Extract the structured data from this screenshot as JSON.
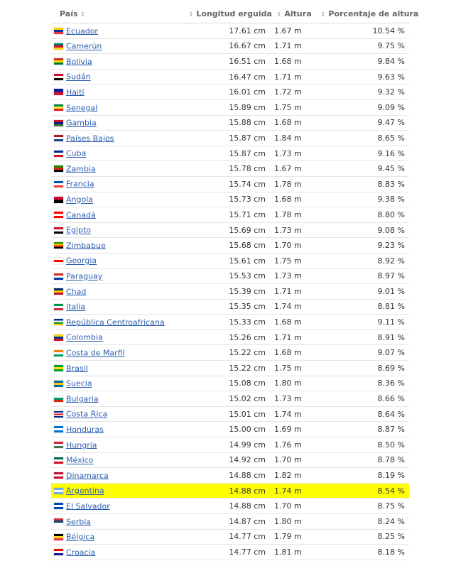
{
  "table": {
    "headers": {
      "country": "País",
      "length": "Longitud erguida",
      "height": "Altura",
      "percent": "Porcentaje de altura"
    },
    "sort_icon": "sort-icon",
    "highlight_color": "#ffff00",
    "link_color": "#2a5db0",
    "rows": [
      {
        "country": "Ecuador",
        "length": "17.61 cm",
        "height": "1.67 m",
        "percent": "10.54 %",
        "flag": [
          "#ffd100",
          "#0033a0",
          "#ef3340"
        ]
      },
      {
        "country": "Camerún",
        "length": "16.67 cm",
        "height": "1.71 m",
        "percent": "9.75 %",
        "flag": [
          "#007a5e",
          "#ce1126",
          "#fcd116"
        ]
      },
      {
        "country": "Bolivia",
        "length": "16.51 cm",
        "height": "1.68 m",
        "percent": "9.84 %",
        "flag": [
          "#d52b1e",
          "#f9e300",
          "#007934"
        ]
      },
      {
        "country": "Sudán",
        "length": "16.47 cm",
        "height": "1.71 m",
        "percent": "9.63 %",
        "flag": [
          "#d21034",
          "#ffffff",
          "#000000"
        ]
      },
      {
        "country": "Haití",
        "length": "16.01 cm",
        "height": "1.72 m",
        "percent": "9.32 %",
        "flag": [
          "#00209f",
          "#d21034"
        ]
      },
      {
        "country": "Senegal",
        "length": "15.89 cm",
        "height": "1.75 m",
        "percent": "9.09 %",
        "flag": [
          "#00853f",
          "#fdef42",
          "#e31b23"
        ]
      },
      {
        "country": "Gambia",
        "length": "15.88 cm",
        "height": "1.68 m",
        "percent": "9.47 %",
        "flag": [
          "#ce1126",
          "#0c1c8c",
          "#3a7728"
        ]
      },
      {
        "country": "Países Bajos",
        "length": "15.87 cm",
        "height": "1.84 m",
        "percent": "8.65 %",
        "flag": [
          "#ae1c28",
          "#ffffff",
          "#21468b"
        ]
      },
      {
        "country": "Cuba",
        "length": "15.87 cm",
        "height": "1.73 m",
        "percent": "9.16 %",
        "flag": [
          "#002a8f",
          "#ffffff",
          "#cf142b"
        ]
      },
      {
        "country": "Zambia",
        "length": "15.78 cm",
        "height": "1.67 m",
        "percent": "9.45 %",
        "flag": [
          "#198a00",
          "#de2010",
          "#000000"
        ]
      },
      {
        "country": "Francia",
        "length": "15.74 cm",
        "height": "1.78 m",
        "percent": "8.83 %",
        "flag": [
          "#0055a4",
          "#ffffff",
          "#ef4135"
        ]
      },
      {
        "country": "Angola",
        "length": "15.73 cm",
        "height": "1.68 m",
        "percent": "9.38 %",
        "flag": [
          "#cc092f",
          "#000000"
        ]
      },
      {
        "country": "Canadá",
        "length": "15.71 cm",
        "height": "1.78 m",
        "percent": "8.80 %",
        "flag": [
          "#ff0000",
          "#ffffff",
          "#ff0000"
        ]
      },
      {
        "country": "Egipto",
        "length": "15.69 cm",
        "height": "1.73 m",
        "percent": "9.08 %",
        "flag": [
          "#ce1126",
          "#ffffff",
          "#000000"
        ]
      },
      {
        "country": "Zimbabue",
        "length": "15.68 cm",
        "height": "1.70 m",
        "percent": "9.23 %",
        "flag": [
          "#319208",
          "#ffd200",
          "#de2010",
          "#000000"
        ]
      },
      {
        "country": "Georgia",
        "length": "15.61 cm",
        "height": "1.75 m",
        "percent": "8.92 %",
        "flag": [
          "#ffffff",
          "#ff0000",
          "#ffffff"
        ]
      },
      {
        "country": "Paraguay",
        "length": "15.53 cm",
        "height": "1.73 m",
        "percent": "8.97 %",
        "flag": [
          "#d52b1e",
          "#ffffff",
          "#0038a8"
        ]
      },
      {
        "country": "Chad",
        "length": "15.39 cm",
        "height": "1.71 m",
        "percent": "9.01 %",
        "flag": [
          "#002664",
          "#fecb00",
          "#c60c30"
        ]
      },
      {
        "country": "Italia",
        "length": "15.35 cm",
        "height": "1.74 m",
        "percent": "8.81 %",
        "flag": [
          "#009246",
          "#ffffff",
          "#ce2b37"
        ]
      },
      {
        "country": "República Centroafricana",
        "length": "15.33 cm",
        "height": "1.68 m",
        "percent": "9.11 %",
        "flag": [
          "#003082",
          "#ffffff",
          "#289728",
          "#ffce00"
        ]
      },
      {
        "country": "Colombia",
        "length": "15.26 cm",
        "height": "1.71 m",
        "percent": "8.91 %",
        "flag": [
          "#fcd116",
          "#003893",
          "#ce1126"
        ]
      },
      {
        "country": "Costa de Marfil",
        "length": "15.22 cm",
        "height": "1.68 m",
        "percent": "9.07 %",
        "flag": [
          "#f77f00",
          "#ffffff",
          "#009e60"
        ]
      },
      {
        "country": "Brasil",
        "length": "15.22 cm",
        "height": "1.75 m",
        "percent": "8.69 %",
        "flag": [
          "#009c3b",
          "#ffdf00",
          "#009c3b"
        ]
      },
      {
        "country": "Suecia",
        "length": "15.08 cm",
        "height": "1.80 m",
        "percent": "8.36 %",
        "flag": [
          "#006aa7",
          "#fecc00",
          "#006aa7"
        ]
      },
      {
        "country": "Bulgaria",
        "length": "15.02 cm",
        "height": "1.73 m",
        "percent": "8.66 %",
        "flag": [
          "#ffffff",
          "#00966e",
          "#d62612"
        ]
      },
      {
        "country": "Costa Rica",
        "length": "15.01 cm",
        "height": "1.74 m",
        "percent": "8.64 %",
        "flag": [
          "#002b7f",
          "#ffffff",
          "#ce1126",
          "#ffffff",
          "#002b7f"
        ]
      },
      {
        "country": "Honduras",
        "length": "15.00 cm",
        "height": "1.69 m",
        "percent": "8.87 %",
        "flag": [
          "#0073cf",
          "#ffffff",
          "#0073cf"
        ]
      },
      {
        "country": "Hungría",
        "length": "14.99 cm",
        "height": "1.76 m",
        "percent": "8.50 %",
        "flag": [
          "#ce2939",
          "#ffffff",
          "#477050"
        ]
      },
      {
        "country": "México",
        "length": "14.92 cm",
        "height": "1.70 m",
        "percent": "8.78 %",
        "flag": [
          "#006847",
          "#ffffff",
          "#ce1126"
        ]
      },
      {
        "country": "Dinamarca",
        "length": "14.88 cm",
        "height": "1.82 m",
        "percent": "8.19 %",
        "flag": [
          "#c8102e",
          "#ffffff",
          "#c8102e"
        ]
      },
      {
        "country": "Argentina",
        "length": "14.88 cm",
        "height": "1.74 m",
        "percent": "8.54 %",
        "flag": [
          "#74acdf",
          "#ffffff",
          "#74acdf"
        ],
        "highlight": true
      },
      {
        "country": "El Salvador",
        "length": "14.88 cm",
        "height": "1.70 m",
        "percent": "8.75 %",
        "flag": [
          "#0047ab",
          "#ffffff",
          "#0047ab"
        ]
      },
      {
        "country": "Serbia",
        "length": "14.87 cm",
        "height": "1.80 m",
        "percent": "8.24 %",
        "flag": [
          "#c6363c",
          "#0c4076",
          "#ffffff"
        ]
      },
      {
        "country": "Bélgica",
        "length": "14.77 cm",
        "height": "1.79 m",
        "percent": "8.25 %",
        "flag": [
          "#000000",
          "#fdda24",
          "#ef3340"
        ]
      },
      {
        "country": "Croacia",
        "length": "14.77 cm",
        "height": "1.81 m",
        "percent": "8.18 %",
        "flag": [
          "#ff0000",
          "#ffffff",
          "#171796"
        ]
      }
    ]
  }
}
